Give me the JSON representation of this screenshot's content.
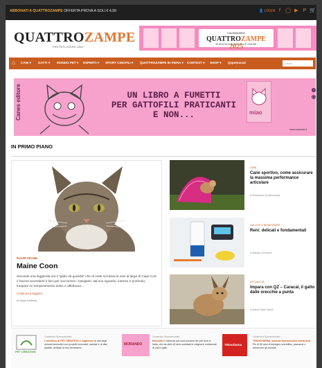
{
  "topbar": {
    "promo_bold": "ABBONATI A QUATTROZAMPE",
    "promo_rest": " OFFERTA PROVA A SOLI € 4,99",
    "login": "LOGIN",
    "icons": [
      "user-icon",
      "facebook-icon",
      "instagram-icon",
      "youtube-icon",
      "pinterest-icon",
      "cart-icon"
    ]
  },
  "logo": {
    "quattro": "QUATTRO",
    "zampe": "ZAMPE",
    "tagline": "PER PETLOVERS ONLY"
  },
  "ad_top": {
    "calendar": "CALENDARIO",
    "brand_a": "QUATTRO",
    "brand_b": "ZAMPE 2025",
    "subtitle": "IN EDICOLA IN EDICOLA E ONLINE"
  },
  "nav": {
    "items": [
      "CANI ▾",
      "GATTI ▾",
      "MONDO PET ▾",
      "ESPERTI ▾",
      "SPORT CINOFILI ▾",
      "QUATTROZAMPE IN FIERA ▾",
      "CONTEST ▾",
      "SHOP ▾",
      "Qzpetsocial"
    ],
    "search_placeholder": "Cerca ..."
  },
  "banner": {
    "side_text": "Canes editore",
    "headline_1": "UN LIBRO A FUMETTI",
    "headline_2": "PER GATTOFILI PRATICANTI",
    "headline_3": "E NON...",
    "book_title": "miao",
    "url": "www.caneesi.it"
  },
  "section_title": "IN PRIMO PIANO",
  "main_article": {
    "category": "RAZZE FELINE",
    "title": "Maine Coon",
    "excerpt": "Secondo una leggenda era il “gatto da guardia” che di notte scrutava le navi al largo di Cape Cod e faceva accendere il faro per soccorrere i naviganti: dal suo sguardo, intenso e profondo, traspare un temperamento dolce e affettuoso…",
    "more": "Continua a leggere",
    "author": "di Giulia Sellema"
  },
  "side_articles": [
    {
      "category": "CANI",
      "title": "Cane sportivo, come assicurare la massima performance articolare",
      "author": "di Redazione Quattrozampe"
    },
    {
      "category": "SALUTE E BENESSERE",
      "title": "Reni: delicati e fondamentali",
      "author": "di Marisa Leonardini"
    },
    {
      "category": "ATTUALITÀ",
      "title": "Impara con QZ – Caracal, il gatto dalle orecchie a punta",
      "author": "di Maria Paola Gianni"
    }
  ],
  "sponsors": [
    {
      "label": "Contenuto Sponsorizzato",
      "logo": "PET CREATION",
      "text_bold": "L'obiettivo di PET CREATION è migliorare",
      "text": " la vita degli animali domestici con prodotti innovativi, salutari e di alta qualità, dedicati al loro benessere."
    },
    {
      "label": "Contenuto Sponsorizzato",
      "logo": "MORANDO",
      "text_bold": "Morando",
      "text": " è l'azienda pet food pioniera del pet food in Italia, che da oltre 60 anni soddisfa le esigenze nutrizionali di cani e gatti."
    },
    {
      "label": "Contenuto Sponsorizzato",
      "logo": "Teknofarma",
      "text_bold": "TEKNOFARMA, azienda farmaceutica veterinaria.",
      "text": " Più di 50 anni di impegno scientifico, passione e amore per gli animali."
    }
  ],
  "colors": {
    "accent": "#c95c1f",
    "pink": "#f6a2cc",
    "dark": "#1f1f1f"
  }
}
